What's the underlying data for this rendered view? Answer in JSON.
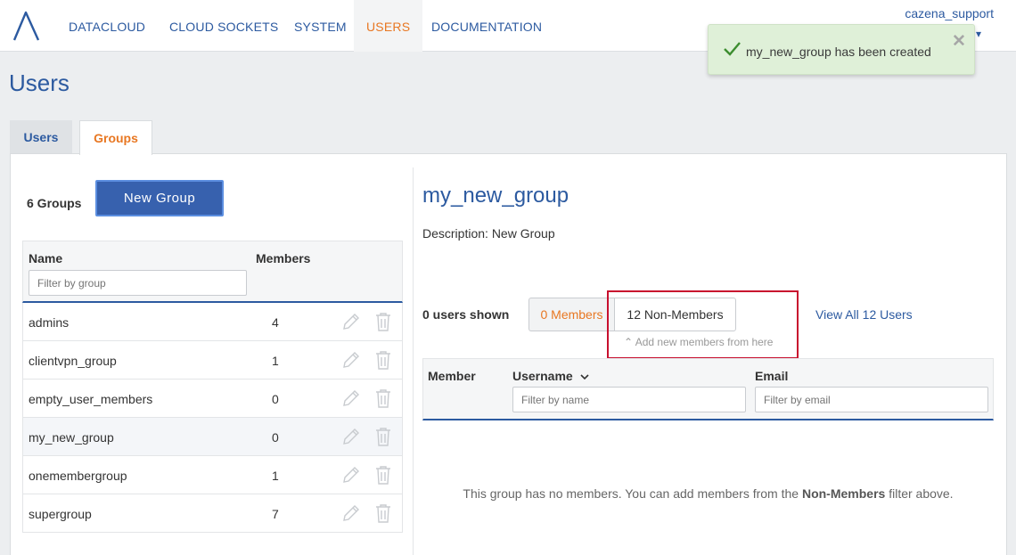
{
  "nav": {
    "items": [
      "DATACLOUD",
      "CLOUD SOCKETS",
      "SYSTEM",
      "USERS",
      "DOCUMENTATION"
    ],
    "active": "USERS",
    "user": "cazena_support"
  },
  "toast": {
    "message": "my_new_group has been created",
    "close_symbol": "✕",
    "type": "success",
    "color": "#dff0d8"
  },
  "page": {
    "title": "Users"
  },
  "tabs": [
    {
      "label": "Users",
      "active": false
    },
    {
      "label": "Groups",
      "active": true
    }
  ],
  "groups_panel": {
    "count_label": "6 Groups",
    "new_button": "New Group",
    "columns": {
      "name": "Name",
      "members": "Members"
    },
    "filter_placeholder": "Filter by group",
    "rows": [
      {
        "name": "admins",
        "members": "4"
      },
      {
        "name": "clientvpn_group",
        "members": "1"
      },
      {
        "name": "empty_user_members",
        "members": "0"
      },
      {
        "name": "my_new_group",
        "members": "0",
        "selected": true
      },
      {
        "name": "onemembergroup",
        "members": "1"
      },
      {
        "name": "supergroup",
        "members": "7"
      }
    ]
  },
  "detail": {
    "title": "my_new_group",
    "description_label": "Description:",
    "description_value": "New Group",
    "users_shown": "0 users shown",
    "members_toggle": "0 Members",
    "nonmembers_toggle": "12 Non-Members",
    "hint": "Add new members from here",
    "view_all": "View All 12 Users",
    "columns": {
      "member": "Member",
      "username": "Username",
      "email": "Email"
    },
    "name_filter_placeholder": "Filter by name",
    "email_filter_placeholder": "Filter by email",
    "empty_prefix": "This group has no members. You can add members from the",
    "empty_bold": "Non-Members",
    "empty_suffix": "filter above."
  },
  "colors": {
    "brand_blue": "#2c5aa0",
    "accent_orange": "#e87722",
    "button_blue": "#3761ae",
    "highlight_red": "#c8102e"
  }
}
